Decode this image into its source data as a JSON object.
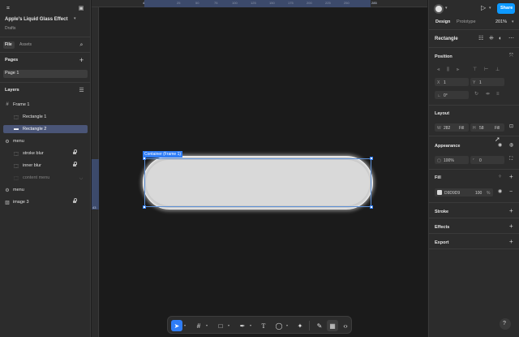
{
  "file": {
    "title": "Apple's Liquid Glass Effect",
    "location": "Drafts",
    "tabs": [
      "File",
      "Assets"
    ]
  },
  "pages": {
    "header": "Pages",
    "items": [
      "Page 1"
    ]
  },
  "layers": {
    "header": "Layers",
    "items": [
      {
        "label": "Frame 1",
        "icon": "frame-icon"
      },
      {
        "label": "Rectangle 1",
        "icon": "rectangle-icon"
      },
      {
        "label": "Rectangle 2",
        "icon": "rectangle-icon",
        "selected": true
      },
      {
        "label": "menu",
        "icon": "component-icon"
      },
      {
        "label": "stroke blur",
        "icon": "rectangle-icon",
        "locked": true
      },
      {
        "label": "inner blur",
        "icon": "rectangle-icon",
        "locked": true
      },
      {
        "label": "content menu",
        "icon": "rectangle-icon",
        "hidden": true
      },
      {
        "label": "menu",
        "icon": "component-icon"
      },
      {
        "label": "image 3",
        "icon": "image-icon",
        "locked": true
      }
    ]
  },
  "ruler": {
    "top_ticks": [
      "4",
      "25",
      "50",
      "75",
      "100",
      "125",
      "150",
      "175",
      "200",
      "225",
      "250",
      "285"
    ],
    "left_tick": "43"
  },
  "canvas": {
    "frame_label": "Container (Frame 1)",
    "shape_fill": "#D9D9D9",
    "selection_color": "#2F7DF6"
  },
  "header": {
    "share_label": "Share",
    "tabs": [
      "Design",
      "Prototype"
    ],
    "zoom": "201%"
  },
  "design": {
    "selection_name": "Rectangle",
    "position_label": "Position",
    "x_key": "X",
    "x_value": "1",
    "y_key": "Y",
    "y_value": "1",
    "rotation_value": "0°",
    "layout_label": "Layout",
    "w_key": "W",
    "w_value": "282",
    "w_mode": "Fill",
    "h_key": "H",
    "h_value": "58",
    "h_mode": "Fill",
    "appearance_label": "Appearance",
    "opacity_value": "100%",
    "corner_value": "0",
    "fill_label": "Fill",
    "fill_hex": "D9D9D9",
    "fill_opacity": "100",
    "fill_unit": "%",
    "stroke_label": "Stroke",
    "effects_label": "Effects",
    "export_label": "Export"
  },
  "help_label": "?"
}
